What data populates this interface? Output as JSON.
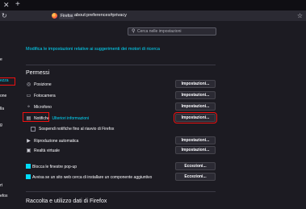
{
  "window": {
    "tab_close_icon": "close-icon",
    "new_tab_icon": "plus-icon"
  },
  "navbar": {
    "identity_label": "Firefox",
    "url": "about:preferences#privacy"
  },
  "search": {
    "placeholder": "Cerca nelle impostazioni"
  },
  "sidebar": {
    "items": [
      {
        "label": "e"
      },
      {
        "label": "ezza",
        "active": true
      },
      {
        "label": "one"
      },
      {
        "label": "lla"
      },
      {
        "label": "g"
      },
      {
        "label": "rt"
      },
      {
        "label": "efox"
      }
    ]
  },
  "main": {
    "search_engines_link": "Modifica le impostazioni relative ai suggerimenti dei motori di ricerca",
    "permissions": {
      "heading": "Permessi",
      "rows": [
        {
          "icon": "location-icon",
          "label": "Posizione",
          "button": "Impostazioni..."
        },
        {
          "icon": "camera-icon",
          "label": "Fotocamera",
          "button": "Impostazioni..."
        },
        {
          "icon": "microphone-icon",
          "label": "Microfono",
          "button": "Impostazioni..."
        },
        {
          "icon": "notification-icon",
          "label": "Notifiche",
          "link": "Ulteriori informazioni",
          "button": "Impostazioni..."
        },
        {
          "icon": "autoplay-icon",
          "label": "Riproduzione automatica",
          "button": "Impostazioni..."
        },
        {
          "icon": "vr-icon",
          "label": "Realtà virtuale",
          "button": "Impostazioni..."
        }
      ],
      "suspend_label": "Sospendi notifiche fino al riavvio di Firefox",
      "popup_label": "Blocca le finestre pop-up",
      "popup_button": "Eccezioni...",
      "warn_label": "Avvisa se un sito web cerca di installare un componente aggiuntivo",
      "warn_button": "Eccezioni..."
    },
    "data_heading": "Raccolta e utilizzo dati di Firefox"
  },
  "colors": {
    "accent": "#00ddff",
    "highlight": "#ee1111",
    "background": "#1c1b22"
  }
}
